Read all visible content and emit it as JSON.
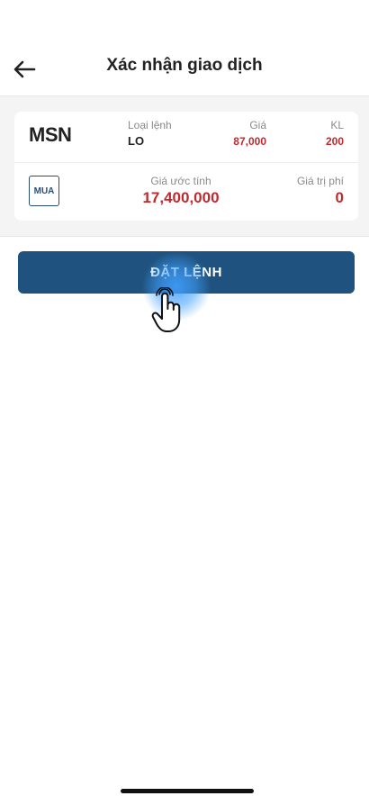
{
  "header": {
    "title": "Xác nhận giao dịch",
    "back_icon": "arrow-left-icon"
  },
  "order": {
    "symbol": "MSN",
    "order_type_label": "Loại lệnh",
    "order_type": "LO",
    "price_label": "Giá",
    "price": "87,000",
    "quantity_label": "KL",
    "quantity": "200",
    "side": "MUA",
    "estimated_label": "Giá ước tính",
    "estimated_value": "17,400,000",
    "fee_label": "Giá trị phí",
    "fee_value": "0"
  },
  "actions": {
    "place_order_label": "ĐẶT LỆNH"
  },
  "colors": {
    "primary": "#1f527e",
    "price_red": "#c0292d",
    "tap_highlight": "#40a0ff"
  }
}
